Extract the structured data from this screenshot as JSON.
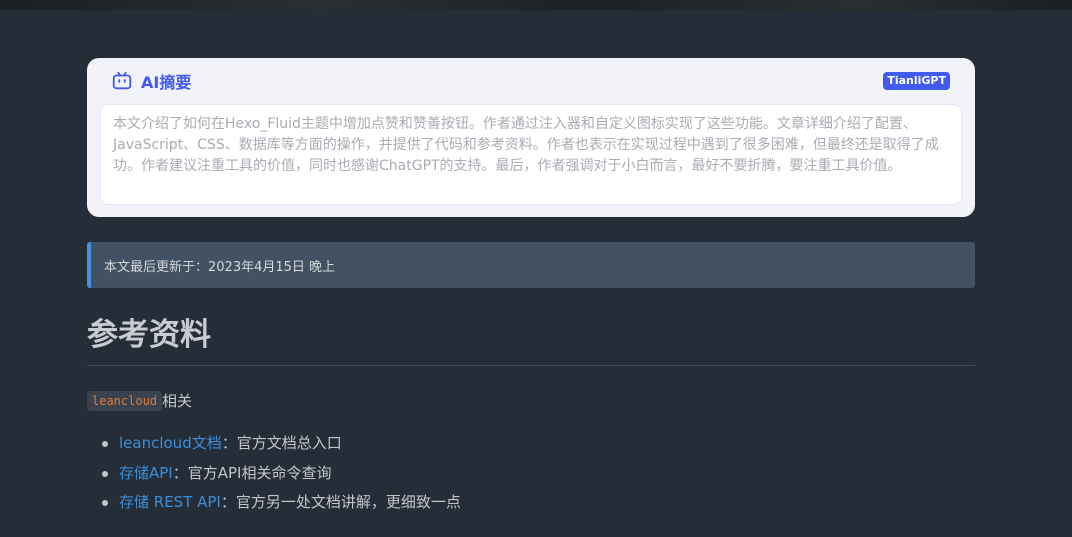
{
  "ai_summary": {
    "title": "AI摘要",
    "badge": "TianliGPT",
    "text": "本文介绍了如何在Hexo_Fluid主题中增加点赞和赞善按钮。作者通过注入器和自定义图标实现了这些功能。文章详细介绍了配置、JavaScript、CSS、数据库等方面的操作，并提供了代码和参考资料。作者也表示在实现过程中遇到了很多困难，但最终还是取得了成功。作者建议注重工具的价值，同时也感谢ChatGPT的支持。最后，作者强调对于小白而言，最好不要折腾，要注重工具价值。",
    "icon": "robot-icon",
    "accent_color": "#425aef"
  },
  "update_note": "本文最后更新于：2023年4月15日 晚上",
  "section": {
    "heading": "参考资料",
    "code_label": "leancloud",
    "code_suffix": "相关",
    "refs": [
      {
        "link": "leancloud文档",
        "desc": "：官方文档总入口"
      },
      {
        "link": "存储API",
        "desc": "：官方API相关命令查询"
      },
      {
        "link": "存储 REST API",
        "desc": "：官方另一处文档讲解，更细致一点"
      }
    ]
  }
}
